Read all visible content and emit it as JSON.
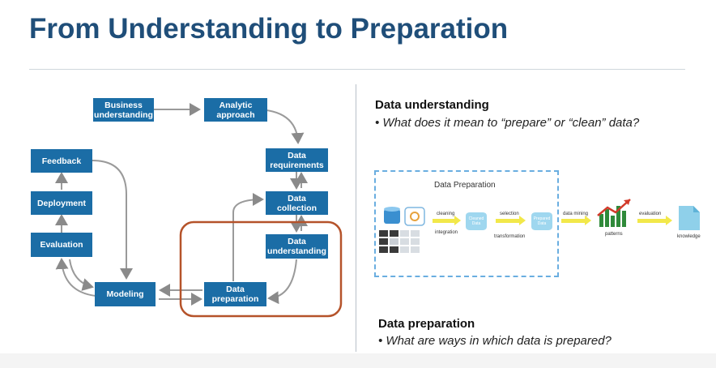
{
  "slide": {
    "title": "From Understanding to Preparation"
  },
  "methodology": {
    "business_understanding": "Business\nunderstanding",
    "analytic_approach": "Analytic\napproach",
    "data_requirements": "Data\nrequirements",
    "data_collection": "Data\ncollection",
    "data_understanding": "Data\nunderstanding",
    "data_preparation": "Data\npreparation",
    "modeling": "Modeling",
    "evaluation": "Evaluation",
    "deployment": "Deployment",
    "feedback": "Feedback"
  },
  "right_panel": {
    "understanding_heading": "Data understanding",
    "understanding_bullet": "What does it mean to “prepare” or “clean” data?",
    "preparation_heading": "Data preparation",
    "preparation_bullet": "What are ways in which data is prepared?"
  },
  "dp_graphic": {
    "title": "Data Preparation",
    "cleaning": "cleaning",
    "integration": "integration",
    "cleaned_data": "Cleaned Data",
    "selection": "selection",
    "transformation": "transformation",
    "prepared_data": "Prepared Data",
    "data_mining": "data mining",
    "patterns": "patterns",
    "evaluation": "evaluation",
    "knowledge": "knowledge"
  },
  "colors": {
    "title": "#1f4e79",
    "box": "#1b6da6",
    "highlight": "#b5532a",
    "dashed_frame": "#6aaee0",
    "arrow_yellow": "#f2e84a"
  }
}
